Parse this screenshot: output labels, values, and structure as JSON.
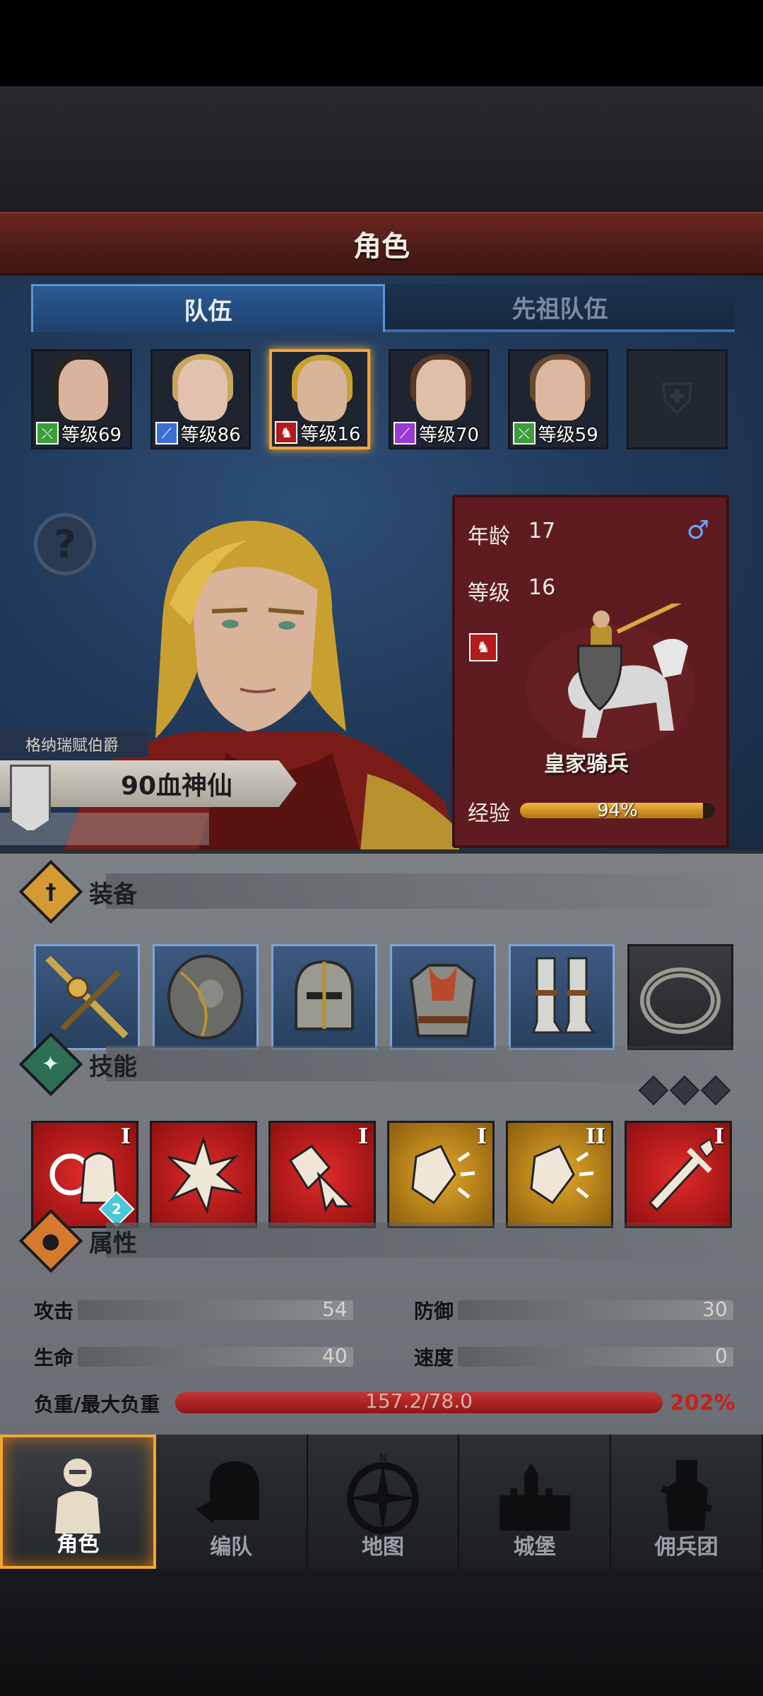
{
  "header": {
    "title": "角色"
  },
  "tabs": [
    {
      "label": "队伍",
      "active": true
    },
    {
      "label": "先祖队伍",
      "active": false
    }
  ],
  "roster": [
    {
      "level_text": "等级69",
      "class_icon": "spear-class-icon",
      "class_color": "#3e9d3a",
      "hair_color": "#2b2320",
      "skin_color": "#d9b39c"
    },
    {
      "level_text": "等级86",
      "class_icon": "sword-class-icon",
      "class_color": "#3a6fd6",
      "hair_color": "#c9a560",
      "skin_color": "#e2c2ae"
    },
    {
      "level_text": "等级16",
      "class_icon": "horse-class-icon",
      "class_color": "#b31a1a",
      "hair_color": "#c9a032",
      "skin_color": "#d8b49a",
      "selected": true
    },
    {
      "level_text": "等级70",
      "class_icon": "staff-class-icon",
      "class_color": "#9a3ad6",
      "hair_color": "#5a3a24",
      "skin_color": "#e0bfa8"
    },
    {
      "level_text": "等级59",
      "class_icon": "spear-class-icon",
      "class_color": "#3e9d3a",
      "hair_color": "#6a4a30",
      "skin_color": "#ddb8a0"
    }
  ],
  "character": {
    "title": "格纳瑞赋伯爵",
    "name": "90血神仙",
    "age_label": "年龄",
    "age": "17",
    "level_label": "等级",
    "level": "16",
    "unit_name": "皇家骑兵",
    "exp_label": "经验",
    "exp_text": "94%",
    "exp_fraction": 0.94
  },
  "sections": {
    "equipment": "装备",
    "skills": "技能",
    "attributes": "属性"
  },
  "equipment": [
    {
      "icon": "sword-icon"
    },
    {
      "icon": "shield-icon"
    },
    {
      "icon": "helmet-icon"
    },
    {
      "icon": "chainmail-armor-icon"
    },
    {
      "icon": "greaves-icon"
    },
    {
      "icon": "ring-icon"
    }
  ],
  "skills": [
    {
      "icon": "horse-target-skill-icon",
      "rank": "I",
      "badge": "2",
      "color": "red"
    },
    {
      "icon": "strike-burst-skill-icon",
      "rank": "",
      "color": "red"
    },
    {
      "icon": "shield-bash-skill-icon",
      "rank": "I",
      "color": "red"
    },
    {
      "icon": "shield-block-skill-icon",
      "rank": "I",
      "color": "gold"
    },
    {
      "icon": "shield-block-skill-icon",
      "rank": "II",
      "color": "gold"
    },
    {
      "icon": "sword-skill-icon",
      "rank": "I",
      "color": "red"
    }
  ],
  "attributes": {
    "attack_label": "攻击",
    "attack": "54",
    "defense_label": "防御",
    "defense": "30",
    "hp_label": "生命",
    "hp": "40",
    "speed_label": "速度",
    "speed": "0",
    "load_label": "负重/最大负重",
    "load_text": "157.2/78.0",
    "load_pct": "202%"
  },
  "nav": [
    {
      "label": "角色",
      "icon": "knight-icon",
      "active": true
    },
    {
      "label": "编队",
      "icon": "helmet-formation-icon",
      "active": false
    },
    {
      "label": "地图",
      "icon": "compass-icon",
      "active": false
    },
    {
      "label": "城堡",
      "icon": "castle-icon",
      "active": false
    },
    {
      "label": "佣兵团",
      "icon": "mercenary-icon",
      "active": false
    }
  ]
}
